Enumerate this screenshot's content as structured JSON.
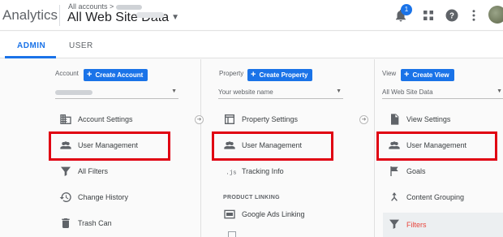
{
  "header": {
    "app_name": "Analytics",
    "breadcrumb": "All accounts >",
    "property_title": "All Web Site Data",
    "notification_count": "1",
    "icons": [
      "bell-icon",
      "apps-grid-icon",
      "help-icon",
      "more-vert-icon",
      "avatar"
    ]
  },
  "tabs": [
    {
      "label": "ADMIN",
      "active": true
    },
    {
      "label": "USER",
      "active": false
    }
  ],
  "account": {
    "heading": "Account",
    "create_label": "Create Account",
    "selected": "",
    "items": [
      {
        "label": "Account Settings",
        "icon": "building-icon"
      },
      {
        "label": "User Management",
        "icon": "people-icon"
      },
      {
        "label": "All Filters",
        "icon": "filter-icon"
      },
      {
        "label": "Change History",
        "icon": "history-icon"
      },
      {
        "label": "Trash Can",
        "icon": "trash-icon"
      }
    ]
  },
  "property": {
    "heading": "Property",
    "create_label": "Create Property",
    "selected": "Your website name",
    "items": [
      {
        "label": "Property Settings",
        "icon": "window-icon"
      },
      {
        "label": "User Management",
        "icon": "people-icon"
      },
      {
        "label": "Tracking Info",
        "icon": "js-icon"
      }
    ],
    "section_label": "PRODUCT LINKING",
    "linking_items": [
      {
        "label": "Google Ads Linking",
        "icon": "ads-icon"
      }
    ]
  },
  "view": {
    "heading": "View",
    "create_label": "Create View",
    "selected": "All Web Site Data",
    "items": [
      {
        "label": "View Settings",
        "icon": "document-icon"
      },
      {
        "label": "User Management",
        "icon": "people-icon"
      },
      {
        "label": "Goals",
        "icon": "flag-icon"
      },
      {
        "label": "Content Grouping",
        "icon": "grouping-icon"
      },
      {
        "label": "Filters",
        "icon": "filter-icon",
        "active": true
      }
    ]
  },
  "colors": {
    "accent": "#1a73e8",
    "highlight": "#e00012",
    "active_text": "#e8453c"
  }
}
